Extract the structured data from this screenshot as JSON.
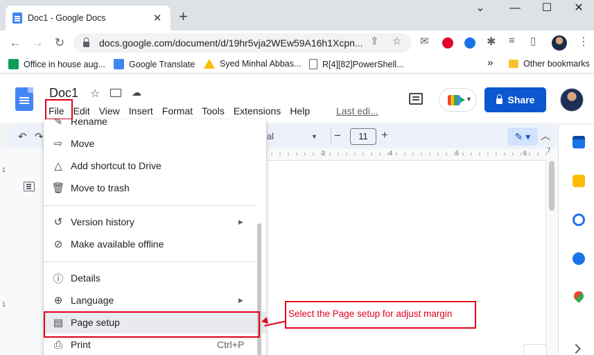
{
  "browser": {
    "tab_title": "Doc1 - Google Docs",
    "url": "docs.google.com/document/d/19hr5vja2WEw59A16h1Xcpn..."
  },
  "bookmarks": [
    {
      "label": "Office in house aug...",
      "icon": "sheets-icon",
      "color": "#0f9d58"
    },
    {
      "label": "Google Translate",
      "icon": "translate-icon",
      "color": "#4285f4"
    },
    {
      "label": "Syed Minhal Abbas...",
      "icon": "drive-icon",
      "color": "#fbbc04"
    },
    {
      "label": "R[4][82]PowerShell...",
      "icon": "page-icon",
      "color": "#5f6368"
    }
  ],
  "bookmarks_overflow": "»",
  "other_bookmarks": "Other bookmarks",
  "doc": {
    "title": "Doc1",
    "menus": [
      "File",
      "Edit",
      "View",
      "Insert",
      "Format",
      "Tools",
      "Extensions",
      "Help"
    ],
    "last_edit": "Last edi...",
    "share_label": "Share"
  },
  "format_toolbar": {
    "font": "al",
    "font_size": "11",
    "minus": "−",
    "plus": "+"
  },
  "ruler": {
    "marks": [
      "3",
      "4",
      "5",
      "6",
      "7"
    ],
    "left_marks": [
      "1",
      "1"
    ]
  },
  "file_menu": {
    "items": [
      {
        "label": "Rename",
        "icon": "rename-icon"
      },
      {
        "label": "Move",
        "icon": "move-folder-icon"
      },
      {
        "label": "Add shortcut to Drive",
        "icon": "drive-shortcut-icon"
      },
      {
        "label": "Move to trash",
        "icon": "trash-icon"
      },
      {
        "label": "Version history",
        "icon": "history-icon",
        "submenu": true
      },
      {
        "label": "Make available offline",
        "icon": "offline-icon"
      },
      {
        "label": "Details",
        "icon": "info-icon"
      },
      {
        "label": "Language",
        "icon": "globe-icon",
        "submenu": true
      },
      {
        "label": "Page setup",
        "icon": "page-setup-icon"
      },
      {
        "label": "Print",
        "icon": "print-icon",
        "shortcut": "Ctrl+P"
      }
    ],
    "submenu_arrow": "▶"
  },
  "annotation": {
    "text": "Select the Page setup for adjust margin",
    "color": "#e0001b"
  },
  "colors": {
    "share_blue": "#0b57d0",
    "toolbar_bg": "#edf2fa",
    "highlight_bg": "#e8eaed"
  }
}
